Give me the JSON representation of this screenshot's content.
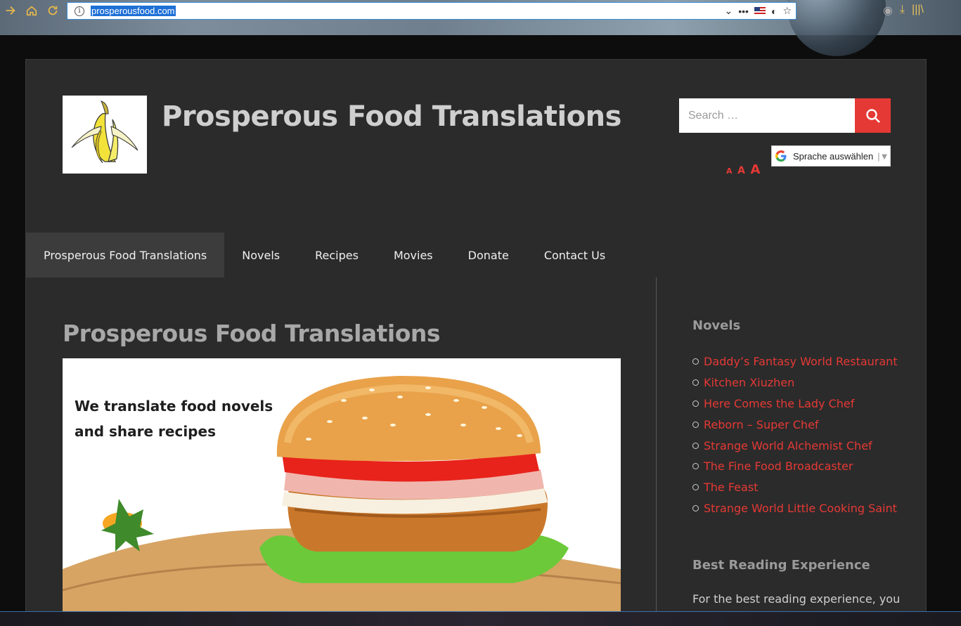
{
  "browser": {
    "url": "prosperousfood.com",
    "icons": [
      "back-arrow-icon",
      "home-icon",
      "reload-icon",
      "info-icon",
      "chevron-down-icon",
      "more-icon",
      "flag-us-icon",
      "tracking-icon",
      "star-icon",
      "sync-icon",
      "download-icon",
      "library-icon"
    ]
  },
  "header": {
    "site_title": "Prosperous Food Translations",
    "search_placeholder": "Search …",
    "translate_label": "Sprache auswählen",
    "font_sizes": [
      "A",
      "A",
      "A"
    ]
  },
  "nav": {
    "items": [
      {
        "label": "Prosperous Food Translations"
      },
      {
        "label": "Novels"
      },
      {
        "label": "Recipes"
      },
      {
        "label": "Movies"
      },
      {
        "label": "Donate"
      },
      {
        "label": "Contact Us"
      }
    ]
  },
  "main": {
    "post_title": "Prosperous Food Translations",
    "hero_line1": "We translate food novels",
    "hero_line2": "and share recipes"
  },
  "sidebar": {
    "novels_title": "Novels",
    "novels": [
      "Daddy’s Fantasy World Restaurant",
      "Kitchen Xiuzhen",
      "Here Comes the Lady Chef",
      "Reborn – Super Chef",
      "Strange World Alchemist Chef",
      "The Fine Food Broadcaster",
      "The Feast",
      "Strange World Little Cooking Saint"
    ],
    "reading_title": "Best Reading Experience",
    "reading_text": "For the best reading experience, you"
  },
  "colors": {
    "accent": "#e53935",
    "background": "#2b2b2b",
    "title": "#cfcfcf"
  }
}
